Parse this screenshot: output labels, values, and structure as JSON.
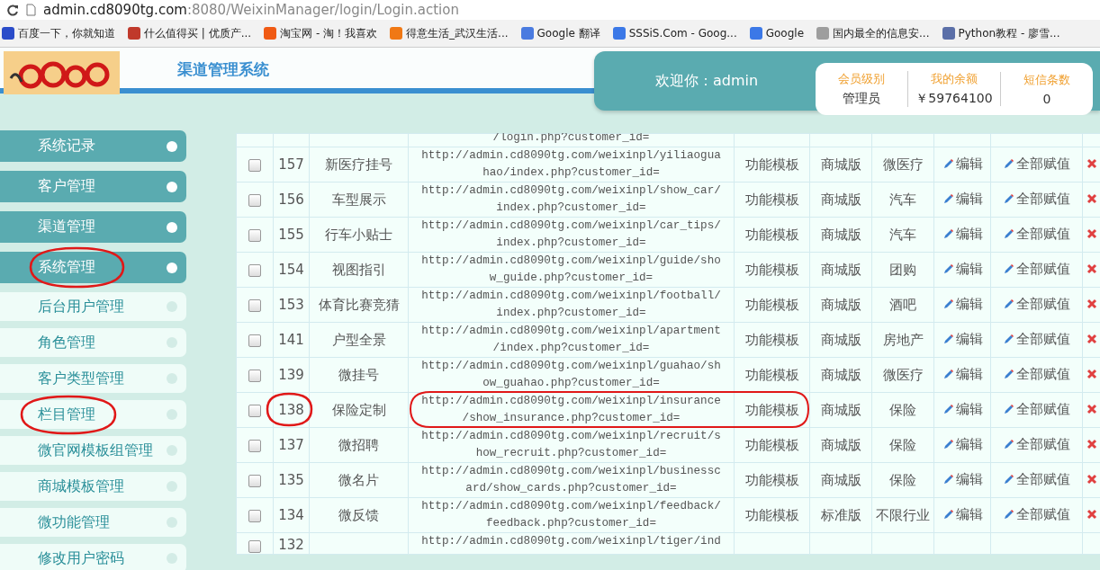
{
  "browser": {
    "url_host": "admin.cd8090tg.com",
    "url_path": ":8080/WeixinManager/login/Login.action",
    "bookmarks": [
      {
        "label": "百度一下，你就知道",
        "color": "#2a4cc9"
      },
      {
        "label": "什么值得买 | 优质产...",
        "color": "#c0392b"
      },
      {
        "label": "淘宝网 - 淘！我喜欢",
        "color": "#f05a14"
      },
      {
        "label": "得意生活_武汉生活...",
        "color": "#f07814"
      },
      {
        "label": "Google 翻译",
        "color": "#4a7be0"
      },
      {
        "label": "SSSiS.Com - Goog...",
        "color": "#3b78e7"
      },
      {
        "label": "Google",
        "color": "#3b78e7"
      },
      {
        "label": "国内最全的信息安...",
        "color": "#9e9e9e"
      },
      {
        "label": "Python教程 - 廖雪...",
        "color": "#5b6fa8"
      }
    ]
  },
  "header": {
    "title": "渠道管理系统",
    "welcome": "欢迎你：admin",
    "stats": [
      {
        "label": "会员级别",
        "value": "管理员"
      },
      {
        "label": "我的余额",
        "value": "￥59764100"
      },
      {
        "label": "短信条数",
        "value": "0"
      }
    ]
  },
  "sidebar": {
    "items": [
      {
        "label": "系统记录",
        "kind": "section"
      },
      {
        "label": "客户管理",
        "kind": "section"
      },
      {
        "label": "渠道管理",
        "kind": "section"
      },
      {
        "label": "系统管理",
        "kind": "section"
      },
      {
        "label": "后台用户管理",
        "kind": "sub"
      },
      {
        "label": "角色管理",
        "kind": "sub"
      },
      {
        "label": "客户类型管理",
        "kind": "sub"
      },
      {
        "label": "栏目管理",
        "kind": "sub"
      },
      {
        "label": "微官网模板组管理",
        "kind": "sub"
      },
      {
        "label": "商城模板管理",
        "kind": "sub"
      },
      {
        "label": "微功能管理",
        "kind": "sub"
      },
      {
        "label": "修改用户密码",
        "kind": "sub"
      }
    ]
  },
  "table": {
    "partial_top_url": "/login.php?customer_id=",
    "rows": [
      {
        "checked": false,
        "id": "157",
        "name": "新医疗挂号",
        "url": [
          "http://admin.cd8090tg.com/weixinpl/yiliaogua",
          "hao/index.php?customer_id="
        ],
        "type": "功能模板",
        "version": "商城版",
        "industry": "微医疗",
        "edit": "编辑",
        "assign": "全部赋值"
      },
      {
        "checked": false,
        "id": "156",
        "name": "车型展示",
        "url": [
          "http://admin.cd8090tg.com/weixinpl/show_car/",
          "index.php?customer_id="
        ],
        "type": "功能模板",
        "version": "商城版",
        "industry": "汽车",
        "edit": "编辑",
        "assign": "全部赋值"
      },
      {
        "checked": false,
        "id": "155",
        "name": "行车小贴士",
        "url": [
          "http://admin.cd8090tg.com/weixinpl/car_tips/",
          "index.php?customer_id="
        ],
        "type": "功能模板",
        "version": "商城版",
        "industry": "汽车",
        "edit": "编辑",
        "assign": "全部赋值"
      },
      {
        "checked": false,
        "id": "154",
        "name": "视图指引",
        "url": [
          "http://admin.cd8090tg.com/weixinpl/guide/sho",
          "w_guide.php?customer_id="
        ],
        "type": "功能模板",
        "version": "商城版",
        "industry": "团购",
        "edit": "编辑",
        "assign": "全部赋值"
      },
      {
        "checked": false,
        "id": "153",
        "name": "体育比赛竞猜",
        "url": [
          "http://admin.cd8090tg.com/weixinpl/football/",
          "index.php?customer_id="
        ],
        "type": "功能模板",
        "version": "商城版",
        "industry": "酒吧",
        "edit": "编辑",
        "assign": "全部赋值"
      },
      {
        "checked": false,
        "id": "141",
        "name": "户型全景",
        "url": [
          "http://admin.cd8090tg.com/weixinpl/apartment",
          "/index.php?customer_id="
        ],
        "type": "功能模板",
        "version": "商城版",
        "industry": "房地产",
        "edit": "编辑",
        "assign": "全部赋值"
      },
      {
        "checked": false,
        "id": "139",
        "name": "微挂号",
        "url": [
          "http://admin.cd8090tg.com/weixinpl/guahao/sh",
          "ow_guahao.php?customer_id="
        ],
        "type": "功能模板",
        "version": "商城版",
        "industry": "微医疗",
        "edit": "编辑",
        "assign": "全部赋值"
      },
      {
        "checked": false,
        "id": "138",
        "name": "保险定制",
        "url": [
          "http://admin.cd8090tg.com/weixinpl/insurance",
          "/show_insurance.php?customer_id="
        ],
        "type": "功能模板",
        "version": "商城版",
        "industry": "保险",
        "edit": "编辑",
        "assign": "全部赋值"
      },
      {
        "checked": false,
        "id": "137",
        "name": "微招聘",
        "url": [
          "http://admin.cd8090tg.com/weixinpl/recruit/s",
          "how_recruit.php?customer_id="
        ],
        "type": "功能模板",
        "version": "商城版",
        "industry": "保险",
        "edit": "编辑",
        "assign": "全部赋值"
      },
      {
        "checked": false,
        "id": "135",
        "name": "微名片",
        "url": [
          "http://admin.cd8090tg.com/weixinpl/businessc",
          "ard/show_cards.php?customer_id="
        ],
        "type": "功能模板",
        "version": "商城版",
        "industry": "保险",
        "edit": "编辑",
        "assign": "全部赋值"
      },
      {
        "checked": false,
        "id": "134",
        "name": "微反馈",
        "url": [
          "http://admin.cd8090tg.com/weixinpl/feedback/",
          "feedback.php?customer_id="
        ],
        "type": "功能模板",
        "version": "标准版",
        "industry": "不限行业",
        "edit": "编辑",
        "assign": "全部赋值"
      },
      {
        "checked": false,
        "id": "132",
        "url": [
          "http://admin.cd8090tg.com/weixinpl/tiger/ind"
        ],
        "kind": "partial"
      }
    ]
  }
}
